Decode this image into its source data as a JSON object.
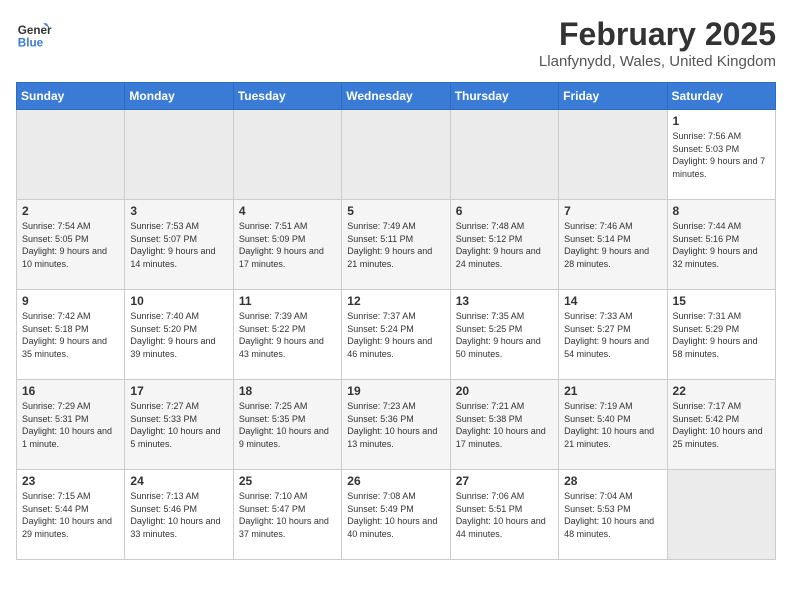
{
  "header": {
    "logo_line1": "General",
    "logo_line2": "Blue",
    "title": "February 2025",
    "subtitle": "Llanfynydd, Wales, United Kingdom"
  },
  "weekdays": [
    "Sunday",
    "Monday",
    "Tuesday",
    "Wednesday",
    "Thursday",
    "Friday",
    "Saturday"
  ],
  "weeks": [
    [
      {
        "day": "",
        "text": ""
      },
      {
        "day": "",
        "text": ""
      },
      {
        "day": "",
        "text": ""
      },
      {
        "day": "",
        "text": ""
      },
      {
        "day": "",
        "text": ""
      },
      {
        "day": "",
        "text": ""
      },
      {
        "day": "1",
        "text": "Sunrise: 7:56 AM\nSunset: 5:03 PM\nDaylight: 9 hours and 7 minutes."
      }
    ],
    [
      {
        "day": "2",
        "text": "Sunrise: 7:54 AM\nSunset: 5:05 PM\nDaylight: 9 hours and 10 minutes."
      },
      {
        "day": "3",
        "text": "Sunrise: 7:53 AM\nSunset: 5:07 PM\nDaylight: 9 hours and 14 minutes."
      },
      {
        "day": "4",
        "text": "Sunrise: 7:51 AM\nSunset: 5:09 PM\nDaylight: 9 hours and 17 minutes."
      },
      {
        "day": "5",
        "text": "Sunrise: 7:49 AM\nSunset: 5:11 PM\nDaylight: 9 hours and 21 minutes."
      },
      {
        "day": "6",
        "text": "Sunrise: 7:48 AM\nSunset: 5:12 PM\nDaylight: 9 hours and 24 minutes."
      },
      {
        "day": "7",
        "text": "Sunrise: 7:46 AM\nSunset: 5:14 PM\nDaylight: 9 hours and 28 minutes."
      },
      {
        "day": "8",
        "text": "Sunrise: 7:44 AM\nSunset: 5:16 PM\nDaylight: 9 hours and 32 minutes."
      }
    ],
    [
      {
        "day": "9",
        "text": "Sunrise: 7:42 AM\nSunset: 5:18 PM\nDaylight: 9 hours and 35 minutes."
      },
      {
        "day": "10",
        "text": "Sunrise: 7:40 AM\nSunset: 5:20 PM\nDaylight: 9 hours and 39 minutes."
      },
      {
        "day": "11",
        "text": "Sunrise: 7:39 AM\nSunset: 5:22 PM\nDaylight: 9 hours and 43 minutes."
      },
      {
        "day": "12",
        "text": "Sunrise: 7:37 AM\nSunset: 5:24 PM\nDaylight: 9 hours and 46 minutes."
      },
      {
        "day": "13",
        "text": "Sunrise: 7:35 AM\nSunset: 5:25 PM\nDaylight: 9 hours and 50 minutes."
      },
      {
        "day": "14",
        "text": "Sunrise: 7:33 AM\nSunset: 5:27 PM\nDaylight: 9 hours and 54 minutes."
      },
      {
        "day": "15",
        "text": "Sunrise: 7:31 AM\nSunset: 5:29 PM\nDaylight: 9 hours and 58 minutes."
      }
    ],
    [
      {
        "day": "16",
        "text": "Sunrise: 7:29 AM\nSunset: 5:31 PM\nDaylight: 10 hours and 1 minute."
      },
      {
        "day": "17",
        "text": "Sunrise: 7:27 AM\nSunset: 5:33 PM\nDaylight: 10 hours and 5 minutes."
      },
      {
        "day": "18",
        "text": "Sunrise: 7:25 AM\nSunset: 5:35 PM\nDaylight: 10 hours and 9 minutes."
      },
      {
        "day": "19",
        "text": "Sunrise: 7:23 AM\nSunset: 5:36 PM\nDaylight: 10 hours and 13 minutes."
      },
      {
        "day": "20",
        "text": "Sunrise: 7:21 AM\nSunset: 5:38 PM\nDaylight: 10 hours and 17 minutes."
      },
      {
        "day": "21",
        "text": "Sunrise: 7:19 AM\nSunset: 5:40 PM\nDaylight: 10 hours and 21 minutes."
      },
      {
        "day": "22",
        "text": "Sunrise: 7:17 AM\nSunset: 5:42 PM\nDaylight: 10 hours and 25 minutes."
      }
    ],
    [
      {
        "day": "23",
        "text": "Sunrise: 7:15 AM\nSunset: 5:44 PM\nDaylight: 10 hours and 29 minutes."
      },
      {
        "day": "24",
        "text": "Sunrise: 7:13 AM\nSunset: 5:46 PM\nDaylight: 10 hours and 33 minutes."
      },
      {
        "day": "25",
        "text": "Sunrise: 7:10 AM\nSunset: 5:47 PM\nDaylight: 10 hours and 37 minutes."
      },
      {
        "day": "26",
        "text": "Sunrise: 7:08 AM\nSunset: 5:49 PM\nDaylight: 10 hours and 40 minutes."
      },
      {
        "day": "27",
        "text": "Sunrise: 7:06 AM\nSunset: 5:51 PM\nDaylight: 10 hours and 44 minutes."
      },
      {
        "day": "28",
        "text": "Sunrise: 7:04 AM\nSunset: 5:53 PM\nDaylight: 10 hours and 48 minutes."
      },
      {
        "day": "",
        "text": ""
      }
    ]
  ]
}
